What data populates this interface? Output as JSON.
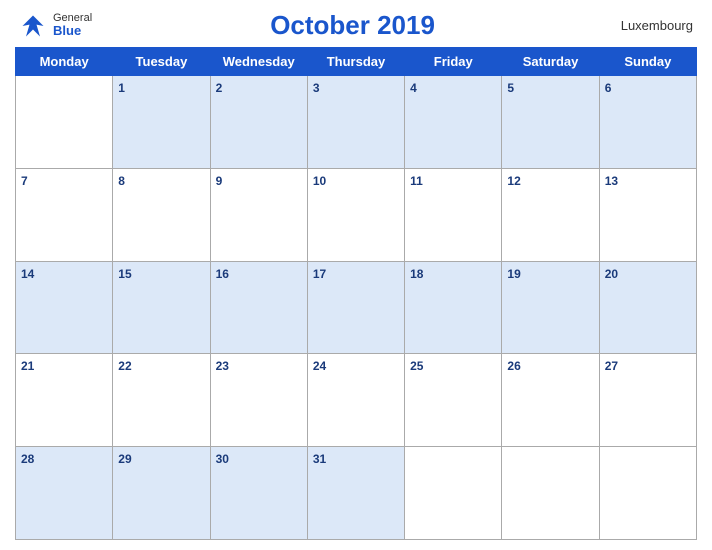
{
  "header": {
    "title": "October 2019",
    "country": "Luxembourg",
    "logo": {
      "general": "General",
      "blue": "Blue"
    }
  },
  "days_of_week": [
    "Monday",
    "Tuesday",
    "Wednesday",
    "Thursday",
    "Friday",
    "Saturday",
    "Sunday"
  ],
  "weeks": [
    [
      null,
      1,
      2,
      3,
      4,
      5,
      6
    ],
    [
      7,
      8,
      9,
      10,
      11,
      12,
      13
    ],
    [
      14,
      15,
      16,
      17,
      18,
      19,
      20
    ],
    [
      21,
      22,
      23,
      24,
      25,
      26,
      27
    ],
    [
      28,
      29,
      30,
      31,
      null,
      null,
      null
    ]
  ]
}
